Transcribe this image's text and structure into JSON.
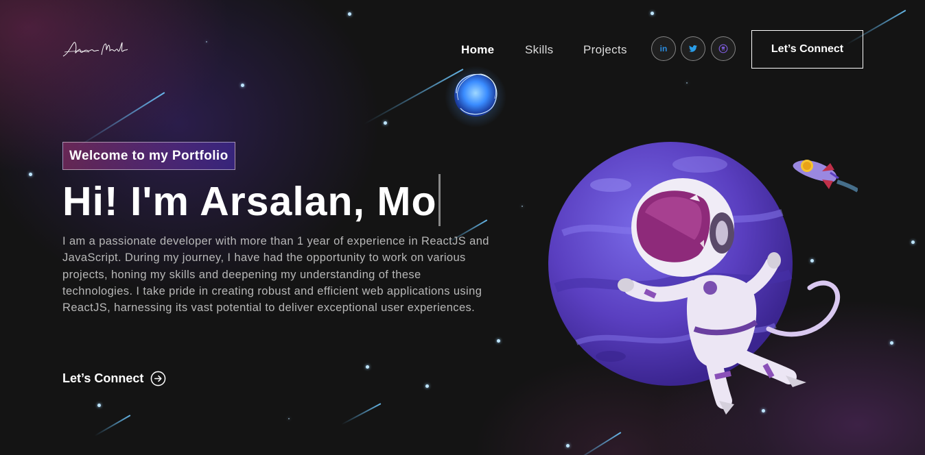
{
  "brand": {
    "logo_text": "Arsalan Malik"
  },
  "nav": {
    "links": [
      {
        "label": "Home"
      },
      {
        "label": "Skills"
      },
      {
        "label": "Projects"
      }
    ],
    "social": [
      {
        "name": "linkedin-icon",
        "glyph": "in"
      },
      {
        "name": "twitter-icon",
        "glyph": ""
      },
      {
        "name": "github-icon",
        "glyph": ""
      }
    ],
    "cta_label": "Let’s Connect"
  },
  "hero": {
    "tagline": "Welcome to my Portfolio",
    "headline": "Hi! I'm Arsalan, Mo",
    "description": "I am a passionate developer with more than 1 year of experience in ReactJS and JavaScript. During my journey, I have had the opportunity to work on various projects, honing my skills and deepening my understanding of these technologies. I take pride in creating robust and efficient web applications using ReactJS, harnessing its vast potential to deliver exceptional user experiences.",
    "cta_label": "Let’s Connect"
  },
  "colors": {
    "background": "#121212",
    "accent_pink": "#aa367c",
    "accent_purple": "#4a2fbd",
    "star": "#bfe6ff"
  }
}
